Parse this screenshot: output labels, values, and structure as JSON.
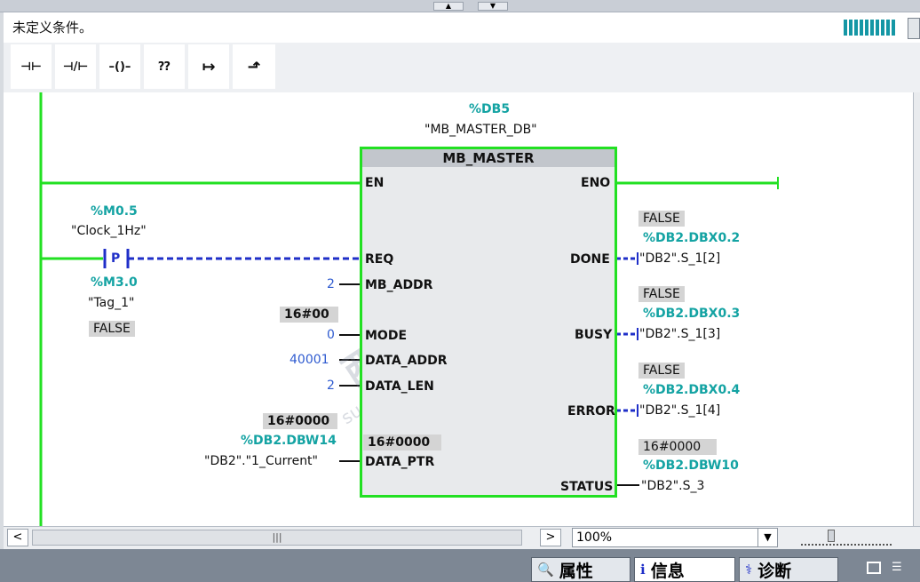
{
  "header": {
    "condition_text": "未定义条件。"
  },
  "instructions": [
    {
      "name": "no-contact-button",
      "glyph": "⊣⊢"
    },
    {
      "name": "nc-contact-button",
      "glyph": "⊣/⊢"
    },
    {
      "name": "coil-button",
      "glyph": "–()–"
    },
    {
      "name": "empty-box-button",
      "glyph": "⁇"
    },
    {
      "name": "open-branch-button",
      "glyph": "↦"
    },
    {
      "name": "close-branch-button",
      "glyph": "⬏"
    }
  ],
  "block": {
    "db_address": "%DB5",
    "db_name": "\"MB_MASTER_DB\"",
    "title": "MB_MASTER",
    "en": "EN",
    "eno": "ENO",
    "inputs": {
      "req": "REQ",
      "mb_addr": "MB_ADDR",
      "mode": "MODE",
      "data_addr": "DATA_ADDR",
      "data_len": "DATA_LEN",
      "data_ptr": "DATA_PTR"
    },
    "outputs": {
      "done": "DONE",
      "busy": "BUSY",
      "error": "ERROR",
      "status": "STATUS"
    },
    "data_ptr_monitor": "16#0000"
  },
  "left": {
    "clock_addr": "%M0.5",
    "clock_name": "\"Clock_1Hz\"",
    "p_label": "P",
    "tag_addr": "%M3.0",
    "tag_name": "\"Tag_1\"",
    "tag_state": "FALSE",
    "mb_addr_value": "2",
    "mode_monitor": "16#00",
    "mode_value": "0",
    "data_addr_value": "40001",
    "data_len_value": "2",
    "ptr_monitor": "16#0000",
    "ptr_addr": "%DB2.DBW14",
    "ptr_name": "\"DB2\".\"1_Current\""
  },
  "right": {
    "done_state": "FALSE",
    "done_addr": "%DB2.DBX0.2",
    "done_name": "\"DB2\".S_1[2]",
    "busy_state": "FALSE",
    "busy_addr": "%DB2.DBX0.3",
    "busy_name": "\"DB2\".S_1[3]",
    "error_state": "FALSE",
    "error_addr": "%DB2.DBX0.4",
    "error_name": "\"DB2\".S_1[4]",
    "status_monitor": "16#0000",
    "status_addr": "%DB2.DBW10",
    "status_name": "\"DB2\".S_3"
  },
  "watermark": {
    "line1": "西门子工业",
    "line2": "找答案",
    "line3": "support.industry.siemens.com/cs"
  },
  "scroll": {
    "zoom": "100%"
  },
  "tabs": [
    {
      "label": "属性"
    },
    {
      "label": "信息"
    },
    {
      "label": "诊断"
    }
  ],
  "colors": {
    "rung_green": "#22e022",
    "link_blue": "#1f2fc8",
    "teal": "#14a3a3"
  }
}
